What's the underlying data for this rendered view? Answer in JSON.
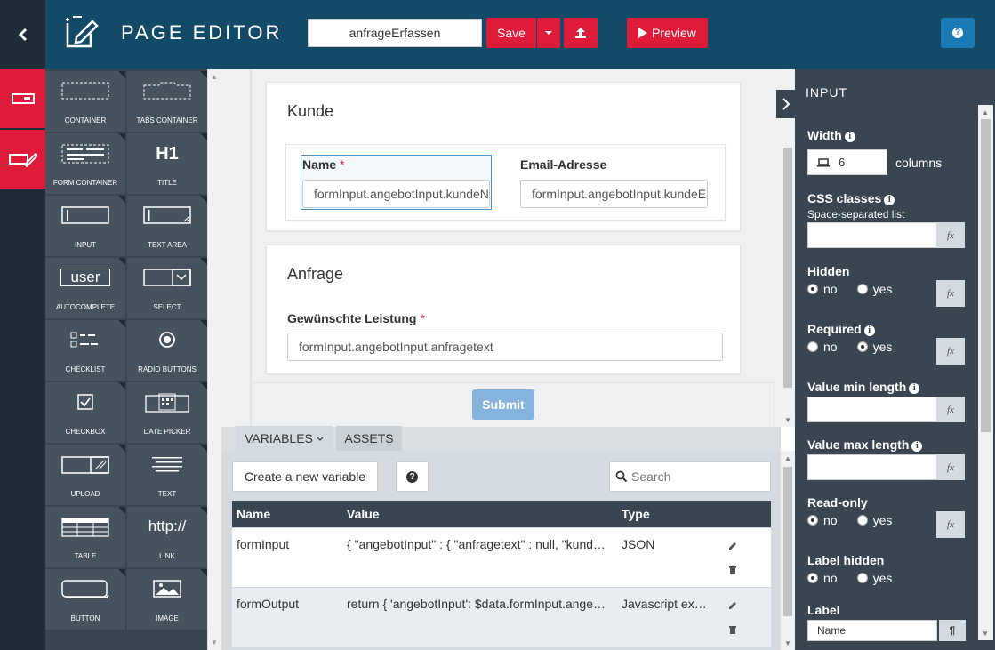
{
  "header": {
    "back_icon": "chevron-left-icon",
    "logo_icon": "edit-page-icon",
    "title": "PAGE EDITOR",
    "page_name": "anfrageErfassen",
    "save_label": "Save",
    "preview_label": "Preview",
    "help_label": "?"
  },
  "palette": {
    "items": [
      {
        "label": "CONTAINER",
        "icon": "container-icon"
      },
      {
        "label": "TABS CONTAINER",
        "icon": "tabs-container-icon"
      },
      {
        "label": "FORM CONTAINER",
        "icon": "form-container-icon"
      },
      {
        "label": "TITLE",
        "icon": "h1-icon",
        "glyph": "H1"
      },
      {
        "label": "INPUT",
        "icon": "input-icon"
      },
      {
        "label": "TEXT AREA",
        "icon": "textarea-icon"
      },
      {
        "label": "AUTOCOMPLETE",
        "icon": "autocomplete-icon",
        "glyph": "user"
      },
      {
        "label": "SELECT",
        "icon": "select-icon"
      },
      {
        "label": "CHECKLIST",
        "icon": "checklist-icon"
      },
      {
        "label": "RADIO BUTTONS",
        "icon": "radio-icon"
      },
      {
        "label": "CHECKBOX",
        "icon": "checkbox-icon"
      },
      {
        "label": "DATE PICKER",
        "icon": "calendar-icon"
      },
      {
        "label": "UPLOAD",
        "icon": "upload-icon"
      },
      {
        "label": "TEXT",
        "icon": "text-icon"
      },
      {
        "label": "TABLE",
        "icon": "table-icon"
      },
      {
        "label": "LINK",
        "icon": "link-icon",
        "glyph": "http://"
      },
      {
        "label": "BUTTON",
        "icon": "button-icon"
      },
      {
        "label": "IMAGE",
        "icon": "image-icon"
      }
    ]
  },
  "canvas": {
    "section1": {
      "title": "Kunde",
      "name_label": "Name",
      "name_value": "formInput.angebotInput.kundeName",
      "email_label": "Email-Adresse",
      "email_value": "formInput.angebotInput.kundeEmail"
    },
    "section2": {
      "title": "Anfrage",
      "service_label": "Gewünschte Leistung",
      "service_value": "formInput.angebotInput.anfragetext"
    },
    "required_mark": "*",
    "submit_label": "Submit"
  },
  "bottom": {
    "tabs": [
      {
        "label": "VARIABLES"
      },
      {
        "label": "ASSETS"
      }
    ],
    "create_label": "Create a new variable",
    "help_label": "?",
    "search_placeholder": "Search",
    "columns": [
      "Name",
      "Value",
      "Type"
    ],
    "rows": [
      {
        "name": "formInput",
        "value": "{ \"angebotInput\" : { \"anfragetext\" : null, \"kundeName\" : null, \"kundeEmail\" : null } }",
        "type": "JSON"
      },
      {
        "name": "formOutput",
        "value": "return { 'angebotInput': $data.formInput.angebotInput };",
        "type": "Javascript expression"
      }
    ]
  },
  "properties": {
    "title": "INPUT",
    "width_label": "Width",
    "width_value": "6",
    "width_unit": "columns",
    "css_label": "CSS classes",
    "css_sub": "Space-separated list",
    "hidden_label": "Hidden",
    "required_label": "Required",
    "min_label": "Value min length",
    "max_label": "Value max length",
    "readonly_label": "Read-only",
    "label_hidden_label": "Label hidden",
    "label_label": "Label",
    "label_value": "Name",
    "no": "no",
    "yes": "yes",
    "fx": "fx",
    "hidden_value": "no",
    "required_value": "yes",
    "readonly_value": "no",
    "label_hidden_value": "no"
  },
  "colors": {
    "header": "#134a68",
    "accent": "#de1b39",
    "panel": "#394551"
  }
}
